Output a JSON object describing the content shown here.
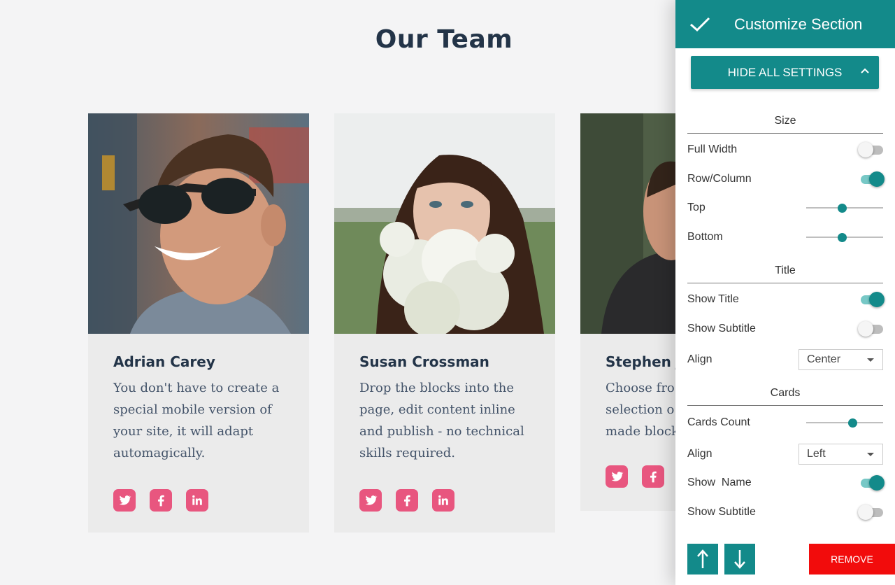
{
  "section": {
    "title": "Our Team"
  },
  "cards": [
    {
      "name": "Adrian Carey",
      "desc": "You don't have to create a special mobile version of your site, it will adapt automagically."
    },
    {
      "name": "Susan Crossman",
      "desc": "Drop the blocks into the page, edit content inline and publish - no technical skills required."
    },
    {
      "name": "Stephen J",
      "desc": "Choose fro selection o made block"
    }
  ],
  "social_icons": [
    "twitter-icon",
    "facebook-icon",
    "linkedin-icon"
  ],
  "panel": {
    "title": "Customize Section",
    "hide_all": "HIDE ALL SETTINGS",
    "groups": {
      "size": "Size",
      "title": "Title",
      "cards": "Cards"
    },
    "labels": {
      "full_width": "Full Width",
      "row_column": "Row/Column",
      "top": "Top",
      "bottom": "Bottom",
      "show_title": "Show Title",
      "show_subtitle": "Show Subtitle",
      "title_align": "Align",
      "cards_count": "Cards Count",
      "cards_align": "Align",
      "show_name": "Show  Name",
      "show_card_subtitle": "Show Subtitle"
    },
    "values": {
      "full_width": false,
      "row_column": true,
      "top": 0.46,
      "bottom": 0.46,
      "show_title": true,
      "show_subtitle": false,
      "title_align": "Center",
      "cards_count": 0.62,
      "cards_align": "Left",
      "show_name": true,
      "show_card_subtitle": false
    },
    "remove": "REMOVE"
  },
  "colors": {
    "accent": "#138a8a",
    "social": "#e8567f",
    "remove": "#f20c0c",
    "heading": "#233448"
  }
}
